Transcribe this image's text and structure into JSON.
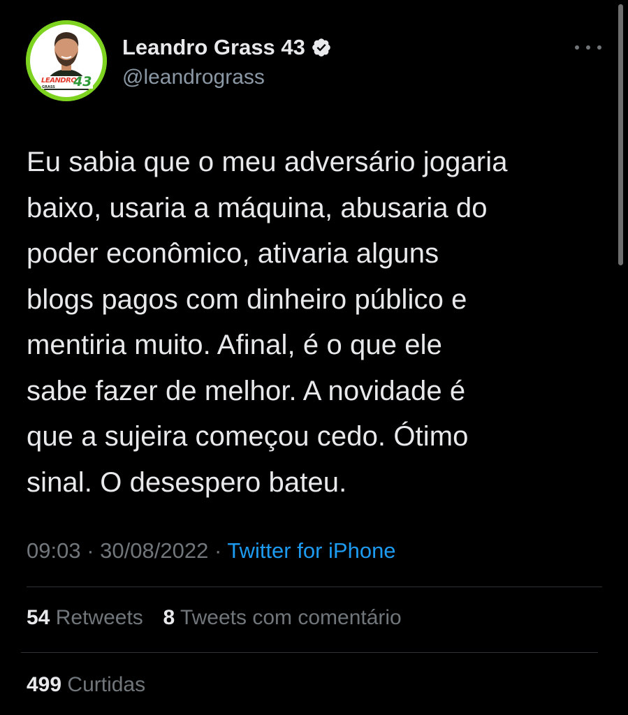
{
  "author": {
    "display_name": "Leandro Grass 43",
    "handle": "@leandrograss",
    "verified_icon": "verified-badge-icon",
    "avatar_logo_text": "LEANDRO",
    "avatar_logo_number": "43",
    "avatar_logo_subtext": "GRASS"
  },
  "tweet": {
    "text": "Eu sabia que o meu adversário jogaria\nbaixo, usaria a máquina, abusaria do\npoder econômico, ativaria alguns\nblogs pagos com dinheiro público e\nmentiria muito. Afinal, é o que ele\nsabe fazer de melhor. A novidade é\nque a sujeira começou cedo. Ótimo\nsinal. O desespero bateu.",
    "time": "09:03",
    "separator": "·",
    "date": "30/08/2022",
    "source": "Twitter for iPhone"
  },
  "stats": {
    "retweets_count": "54",
    "retweets_label": "Retweets",
    "quotes_count": "8",
    "quotes_label": "Tweets com comentário",
    "likes_count": "499",
    "likes_label": "Curtidas"
  },
  "icons": {
    "more": "more-options-icon"
  },
  "colors": {
    "background": "#000000",
    "text_primary": "#e7e9ea",
    "text_secondary": "#71767b",
    "link": "#1d9bf0",
    "avatar_ring": "#7ed321",
    "divider": "#2f3336"
  }
}
